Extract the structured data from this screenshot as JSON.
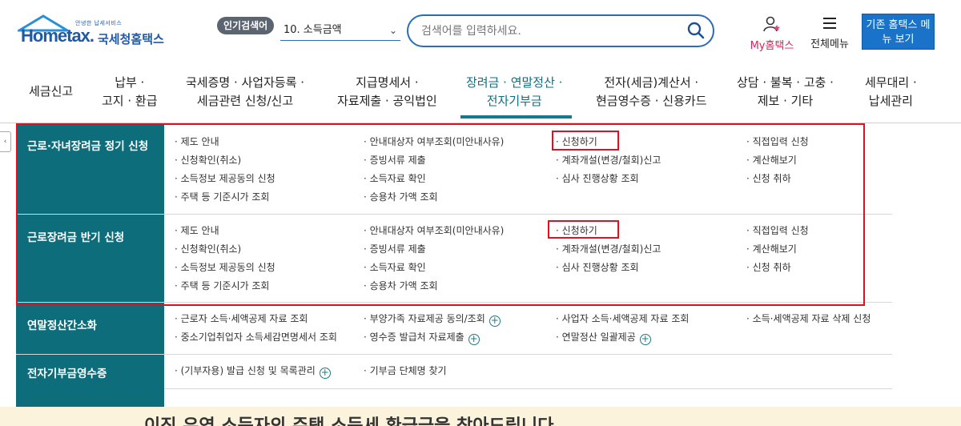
{
  "header": {
    "logo_tag": "안녕한 납세서비스",
    "logo_text": "Hometax.",
    "logo_kr": "국세청홈택스",
    "hot_badge": "인기검색어",
    "hot_selected": "10. 소득금액",
    "search_placeholder": "검색어를 입력하세요.",
    "my_home": "My홈택스",
    "all_menu": "전체메뉴",
    "old_menu": "기존 홈택스 메뉴 보기"
  },
  "gnb": [
    {
      "line1": "세금신고",
      "line2": ""
    },
    {
      "line1": "납부 ·",
      "line2": "고지 · 환급"
    },
    {
      "line1": "국세증명 · 사업자등록 ·",
      "line2": "세금관련 신청/신고"
    },
    {
      "line1": "지급명세서 ·",
      "line2": "자료제출 · 공익법인"
    },
    {
      "line1": "장려금 · 연말정산 ·",
      "line2": "전자기부금"
    },
    {
      "line1": "전자(세금)계산서 ·",
      "line2": "현금영수증 · 신용카드"
    },
    {
      "line1": "상담 · 불복 · 고충 ·",
      "line2": "제보 · 기타"
    },
    {
      "line1": "세무대리 ·",
      "line2": "납세관리"
    }
  ],
  "rows": [
    {
      "title": "근로·자녀장려금 정기 신청",
      "cols": [
        [
          "· 제도 안내",
          "· 신청확인(취소)",
          "· 소득정보 제공동의 신청",
          "· 주택 등 기준시가 조회"
        ],
        [
          "· 안내대상자 여부조회(미안내사유)",
          "· 증빙서류 제출",
          "· 소득자료 확인",
          "· 승용차 가액 조회"
        ],
        [
          "· 신청하기",
          "· 계좌개설(변경/철회)신고",
          "· 심사 진행상황 조회"
        ],
        [
          "· 직접입력 신청",
          "· 계산해보기",
          "· 신청 취하"
        ]
      ]
    },
    {
      "title": "근로장려금 반기 신청",
      "cols": [
        [
          "· 제도 안내",
          "· 신청확인(취소)",
          "· 소득정보 제공동의 신청",
          "· 주택 등 기준시가 조회"
        ],
        [
          "· 안내대상자 여부조회(미안내사유)",
          "· 증빙서류 제출",
          "· 소득자료 확인",
          "· 승용차 가액 조회"
        ],
        [
          "· 신청하기",
          "· 계좌개설(변경/철회)신고",
          "· 심사 진행상황 조회"
        ],
        [
          "· 직접입력 신청",
          "· 계산해보기",
          "· 신청 취하"
        ]
      ]
    },
    {
      "title": "연말정산간소화",
      "cols": [
        [
          "· 근로자 소득·세액공제 자료 조회",
          "· 중소기업취업자 소득세감면명세서 조회"
        ],
        [
          "· 부양가족 자료제공 동의/조회",
          "· 영수증 발급처 자료제출"
        ],
        [
          "· 사업자 소득·세액공제 자료 조회",
          "· 연말정산 일괄제공"
        ],
        [
          "· 소득·세액공제 자료 삭제 신청"
        ]
      ]
    },
    {
      "title": "전자기부금영수증",
      "cols": [
        [
          "· (기부자용) 발급 신청 및 목록관리"
        ],
        [
          "· 기부금 단체명 찾기"
        ]
      ]
    }
  ],
  "plus_symbol": "+",
  "banner_text": "이직 유역 소득자의 주택 소득세 환급금을 찾아드립니다"
}
